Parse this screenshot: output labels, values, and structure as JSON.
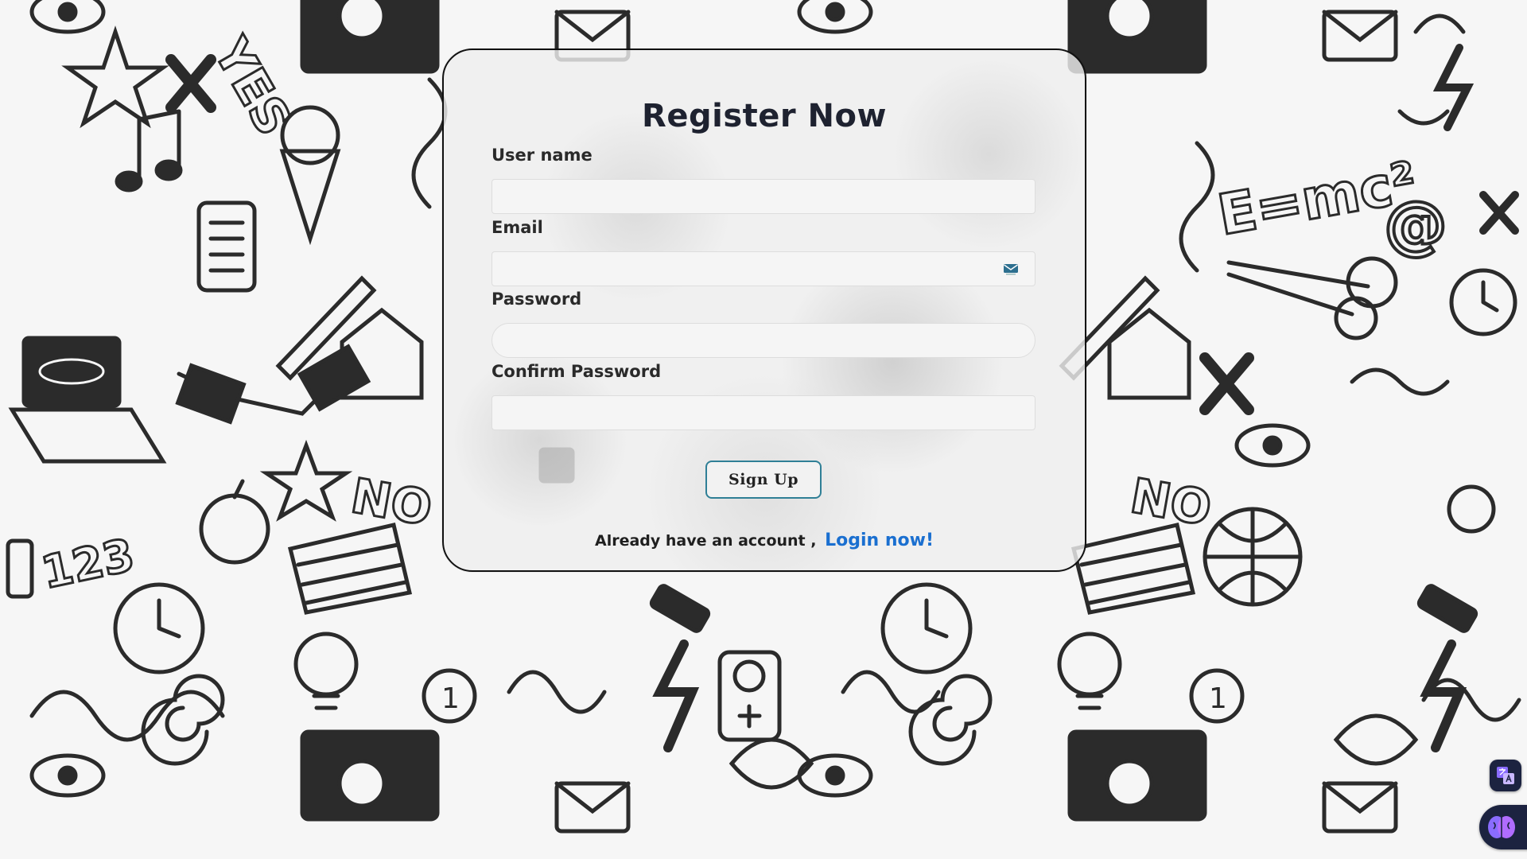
{
  "form": {
    "title": "Register Now",
    "fields": [
      {
        "label": "User name",
        "value": "",
        "placeholder": ""
      },
      {
        "label": "Email",
        "value": "",
        "placeholder": ""
      },
      {
        "label": "Password",
        "value": "",
        "placeholder": ""
      },
      {
        "label": "Confirm Password",
        "value": "",
        "placeholder": ""
      }
    ],
    "submit_label": "Sign Up",
    "login_prompt": "Already have an account ,",
    "login_link": "Login now!"
  },
  "colors": {
    "title": "#1e2230",
    "link": "#1a6fd0",
    "button_border": "#2f7f96",
    "card_border": "#111111"
  },
  "icons": {
    "email_field": "envelope-icon",
    "extension_top": "translate-icon",
    "extension_bottom": "brain-icon"
  }
}
